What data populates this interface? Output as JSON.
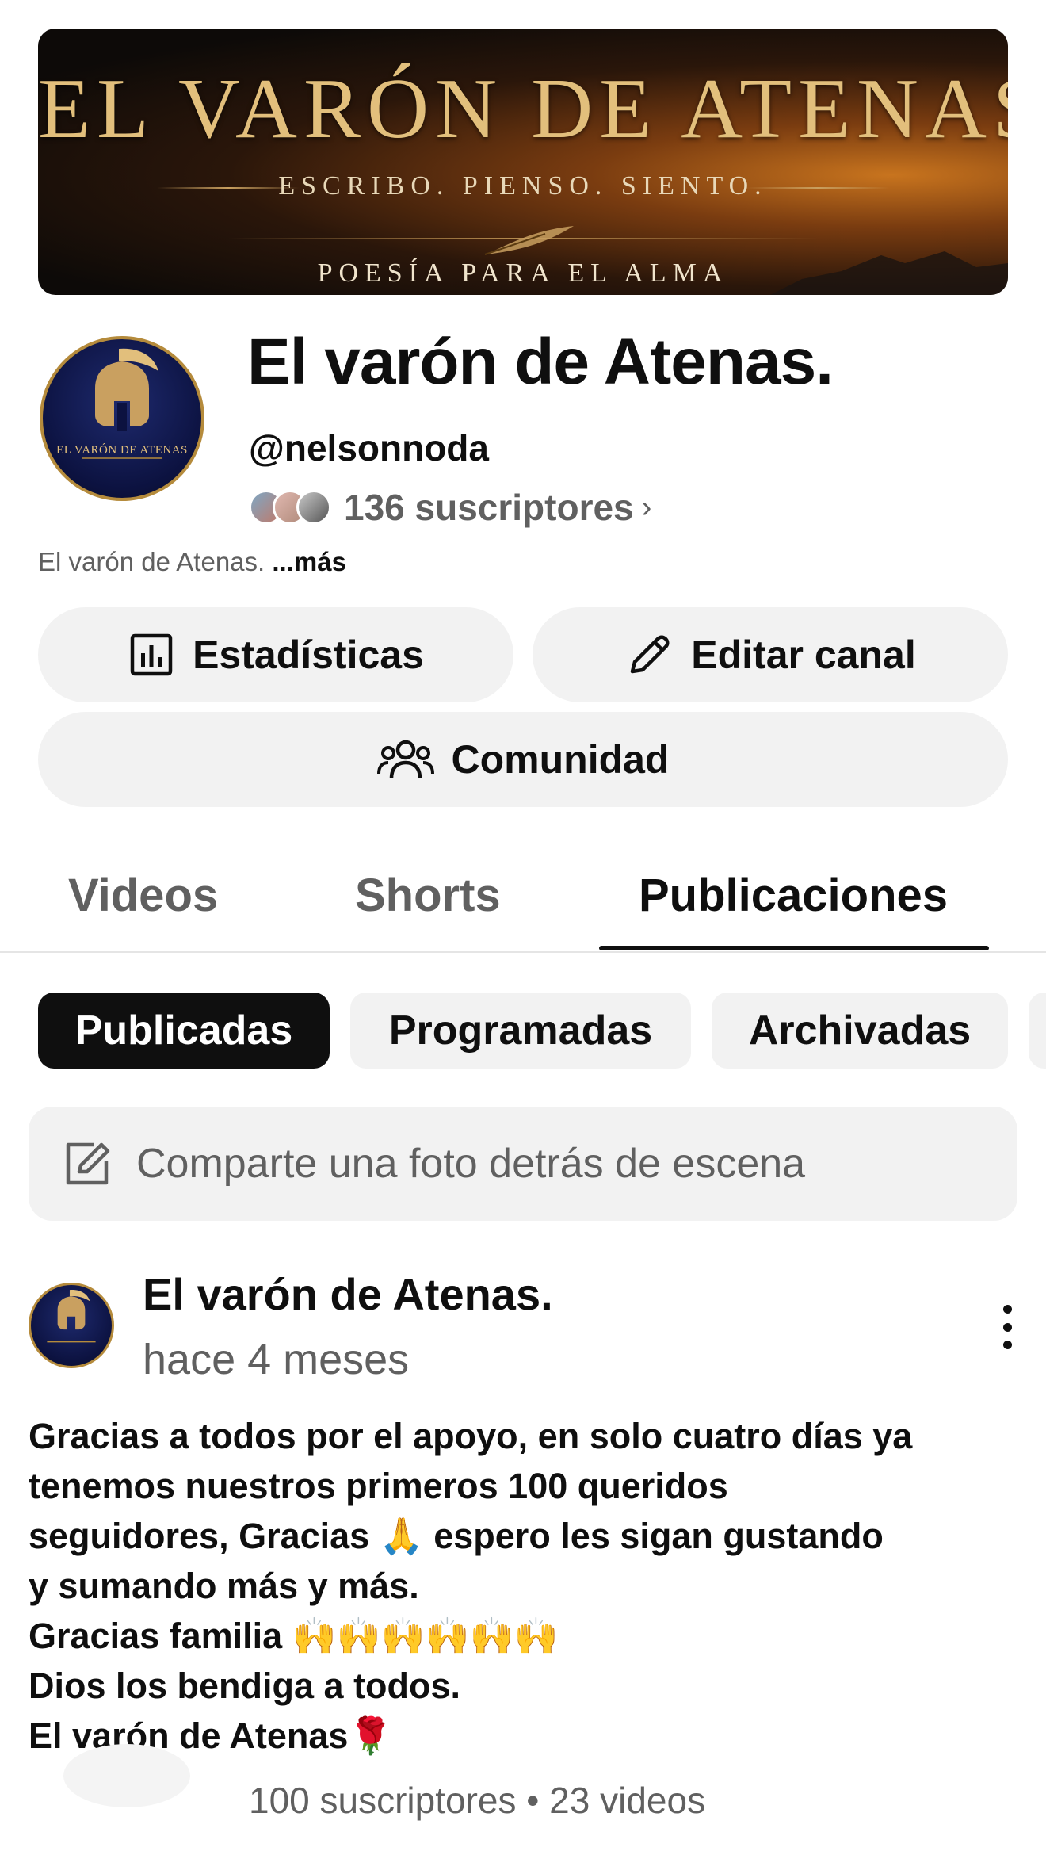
{
  "banner": {
    "title": "EL VARÓN DE ATENAS",
    "subtitle": "ESCRIBO. PIENSO. SIENTO.",
    "tagline": "POESÍA PARA EL ALMA"
  },
  "channel": {
    "avatar_text": "EL VARÓN DE ATENAS",
    "name": "El varón de Atenas.",
    "handle": "@nelsonnoda",
    "subscribers": "136 suscriptores",
    "description": "El varón de Atenas.",
    "more_label": "...más"
  },
  "actions": {
    "stats_label": "Estadísticas",
    "edit_label": "Editar canal",
    "community_label": "Comunidad"
  },
  "tabs": [
    {
      "label": "Videos",
      "active": false
    },
    {
      "label": "Shorts",
      "active": false
    },
    {
      "label": "Publicaciones",
      "active": true
    }
  ],
  "chips": [
    {
      "label": "Publicadas",
      "active": true
    },
    {
      "label": "Programadas",
      "active": false
    },
    {
      "label": "Archivadas",
      "active": false
    }
  ],
  "composer": {
    "placeholder": "Comparte una foto detrás de escena"
  },
  "post": {
    "author": "El varón de Atenas.",
    "time": "hace 4 meses",
    "body": "Gracias a todos por el apoyo, en solo cuatro días ya\ntenemos nuestros primeros 100 queridos\nseguidores, Gracias 🙏 espero les sigan gustando\ny sumando más y más.\nGracias familia 🙌🙌🙌🙌🙌🙌\nDios los bendiga a todos.\n El varón de Atenas🌹"
  },
  "footer": {
    "stats": "100 suscriptores • 23 videos"
  },
  "colors": {
    "text_primary": "#0f0f0f",
    "text_secondary": "#606060",
    "chip_bg": "#f2f2f2",
    "banner_gold": "#e2bf7c"
  }
}
